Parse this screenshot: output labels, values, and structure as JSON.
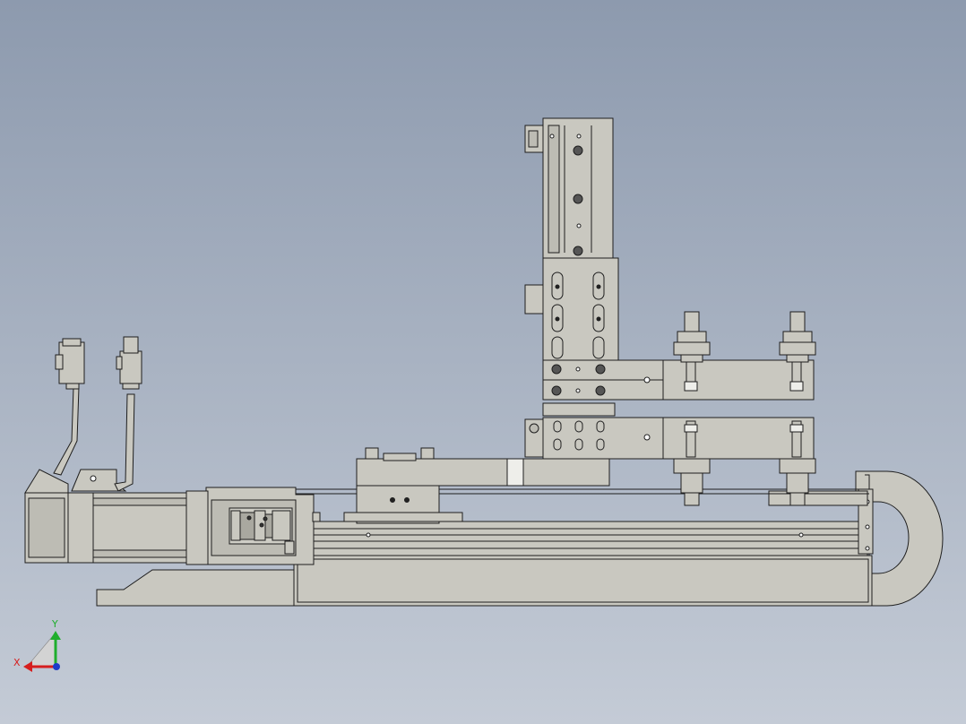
{
  "viewport": {
    "background_top": "#8d9aae",
    "background_bottom": "#c4cbd6",
    "part_fill": "#c9c8c0",
    "part_fill_dark": "#bdbcb4",
    "edge_color": "#1e1e1e"
  },
  "triad": {
    "x_label": "X",
    "y_label": "Y",
    "x_color": "#d61e1e",
    "y_color": "#1fae2c",
    "z_color": "#1e3cc8"
  }
}
